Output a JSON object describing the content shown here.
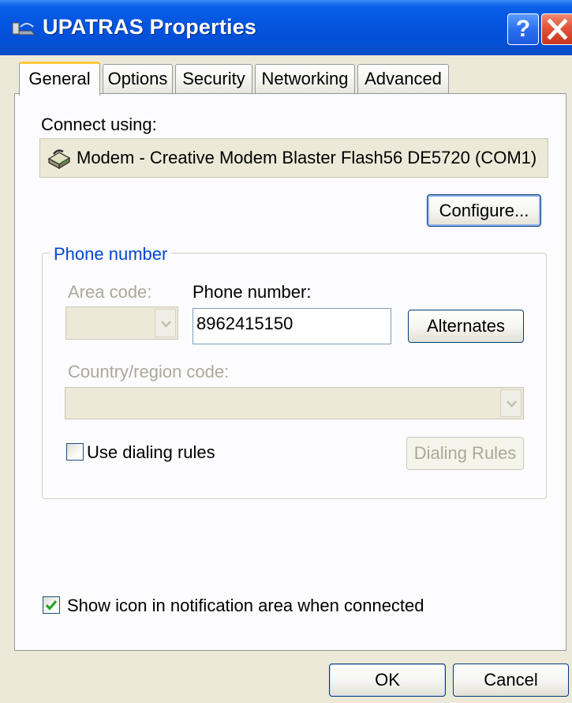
{
  "window": {
    "title": "UPATRAS Properties",
    "help_label": "?",
    "close_label": "✕"
  },
  "tabs": [
    {
      "label": "General",
      "active": true
    },
    {
      "label": "Options",
      "active": false
    },
    {
      "label": "Security",
      "active": false
    },
    {
      "label": "Networking",
      "active": false
    },
    {
      "label": "Advanced",
      "active": false
    }
  ],
  "general": {
    "connect_using_label": "Connect using:",
    "device_name": "Modem - Creative Modem Blaster Flash56 DE5720 (COM1)",
    "configure_label": "Configure...",
    "phone_group": {
      "title": "Phone number",
      "area_code_label": "Area code:",
      "area_code_value": "",
      "phone_number_label": "Phone number:",
      "phone_number_value": "8962415150",
      "alternates_label": "Alternates",
      "country_label": "Country/region code:",
      "country_value": "",
      "use_dialing_rules_label": "Use dialing rules",
      "use_dialing_rules_checked": false,
      "dialing_rules_label": "Dialing Rules"
    },
    "show_icon_label": "Show icon in notification area when connected",
    "show_icon_checked": true
  },
  "footer": {
    "ok_label": "OK",
    "cancel_label": "Cancel"
  },
  "colors": {
    "titlebar": "#0454e0",
    "window_bg": "#ece9d8",
    "group_title": "#0046d5",
    "disabled_text": "#aca899",
    "tab_active_top": "#ffc83c"
  }
}
